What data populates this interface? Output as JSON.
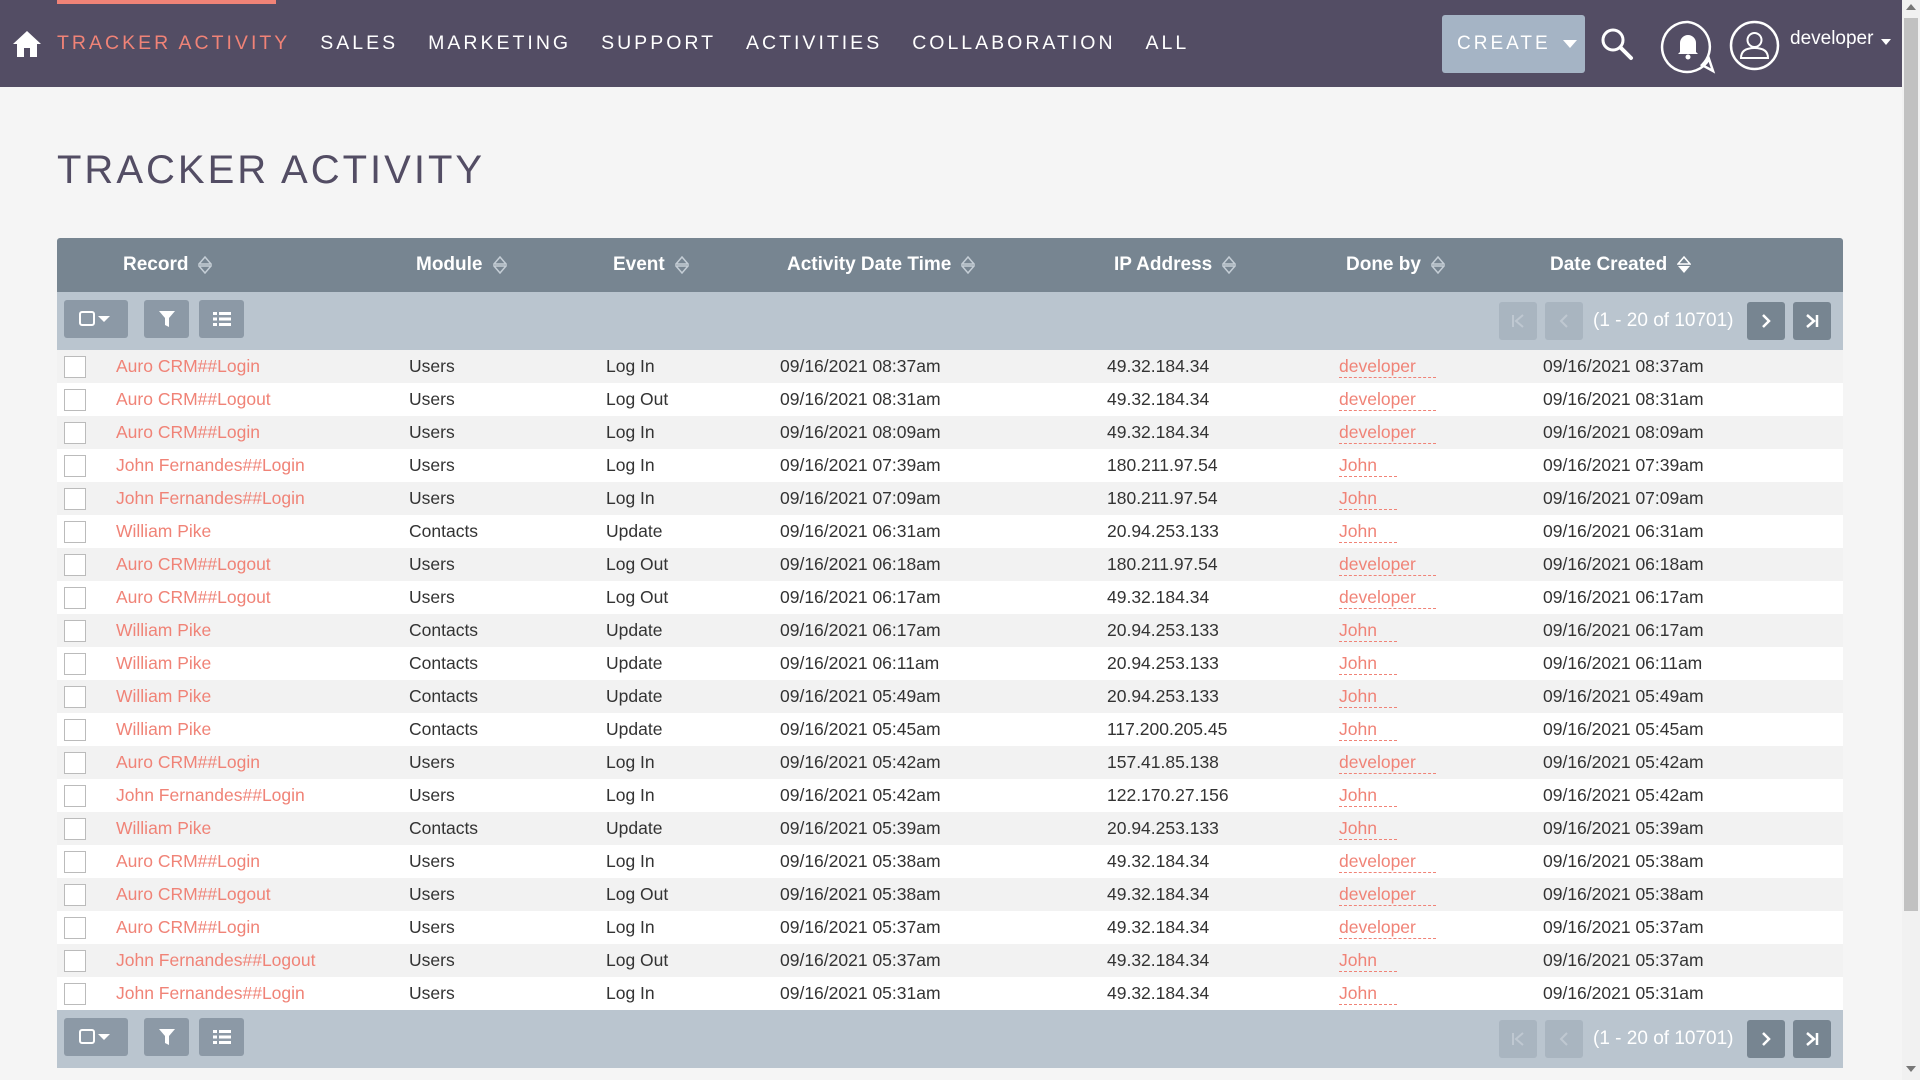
{
  "nav": {
    "items": [
      {
        "label": "TRACKER ACTIVITY",
        "active": true
      },
      {
        "label": "SALES"
      },
      {
        "label": "MARKETING"
      },
      {
        "label": "SUPPORT"
      },
      {
        "label": "ACTIVITIES"
      },
      {
        "label": "COLLABORATION"
      },
      {
        "label": "ALL"
      }
    ],
    "create_label": "CREATE",
    "user_name": "developer",
    "icons": [
      "home-icon",
      "search-icon",
      "bell-icon",
      "user-icon"
    ]
  },
  "colors": {
    "nav_bg": "#534d64",
    "accent": "#f08377",
    "header_bg": "#778591",
    "toolbar_bg": "#bac5cf",
    "create_bg": "#a5b4c5"
  },
  "page": {
    "title": "TRACKER ACTIVITY"
  },
  "table": {
    "columns": [
      "Record",
      "Module",
      "Event",
      "Activity Date Time",
      "IP Address",
      "Done by",
      "Date Created"
    ],
    "sorted_column": "Date Created",
    "pagination": "(1 - 20 of 10701)",
    "rows": [
      {
        "record": "Auro CRM##Login",
        "module": "Users",
        "event": "Log In",
        "activity": "09/16/2021 08:37am",
        "ip": "49.32.184.34",
        "done_by": "developer",
        "created": "09/16/2021 08:37am"
      },
      {
        "record": "Auro CRM##Logout",
        "module": "Users",
        "event": "Log Out",
        "activity": "09/16/2021 08:31am",
        "ip": "49.32.184.34",
        "done_by": "developer",
        "created": "09/16/2021 08:31am"
      },
      {
        "record": "Auro CRM##Login",
        "module": "Users",
        "event": "Log In",
        "activity": "09/16/2021 08:09am",
        "ip": "49.32.184.34",
        "done_by": "developer",
        "created": "09/16/2021 08:09am"
      },
      {
        "record": "John Fernandes##Login",
        "module": "Users",
        "event": "Log In",
        "activity": "09/16/2021 07:39am",
        "ip": "180.211.97.54",
        "done_by": "John",
        "created": "09/16/2021 07:39am"
      },
      {
        "record": "John Fernandes##Login",
        "module": "Users",
        "event": "Log In",
        "activity": "09/16/2021 07:09am",
        "ip": "180.211.97.54",
        "done_by": "John",
        "created": "09/16/2021 07:09am"
      },
      {
        "record": "William Pike",
        "module": "Contacts",
        "event": "Update",
        "activity": "09/16/2021 06:31am",
        "ip": "20.94.253.133",
        "done_by": "John",
        "created": "09/16/2021 06:31am"
      },
      {
        "record": "Auro CRM##Logout",
        "module": "Users",
        "event": "Log Out",
        "activity": "09/16/2021 06:18am",
        "ip": "180.211.97.54",
        "done_by": "developer",
        "created": "09/16/2021 06:18am"
      },
      {
        "record": "Auro CRM##Logout",
        "module": "Users",
        "event": "Log Out",
        "activity": "09/16/2021 06:17am",
        "ip": "49.32.184.34",
        "done_by": "developer",
        "created": "09/16/2021 06:17am"
      },
      {
        "record": "William Pike",
        "module": "Contacts",
        "event": "Update",
        "activity": "09/16/2021 06:17am",
        "ip": "20.94.253.133",
        "done_by": "John",
        "created": "09/16/2021 06:17am"
      },
      {
        "record": "William Pike",
        "module": "Contacts",
        "event": "Update",
        "activity": "09/16/2021 06:11am",
        "ip": "20.94.253.133",
        "done_by": "John",
        "created": "09/16/2021 06:11am"
      },
      {
        "record": "William Pike",
        "module": "Contacts",
        "event": "Update",
        "activity": "09/16/2021 05:49am",
        "ip": "20.94.253.133",
        "done_by": "John",
        "created": "09/16/2021 05:49am"
      },
      {
        "record": "William Pike",
        "module": "Contacts",
        "event": "Update",
        "activity": "09/16/2021 05:45am",
        "ip": "117.200.205.45",
        "done_by": "John",
        "created": "09/16/2021 05:45am"
      },
      {
        "record": "Auro CRM##Login",
        "module": "Users",
        "event": "Log In",
        "activity": "09/16/2021 05:42am",
        "ip": "157.41.85.138",
        "done_by": "developer",
        "created": "09/16/2021 05:42am"
      },
      {
        "record": "John Fernandes##Login",
        "module": "Users",
        "event": "Log In",
        "activity": "09/16/2021 05:42am",
        "ip": "122.170.27.156",
        "done_by": "John",
        "created": "09/16/2021 05:42am"
      },
      {
        "record": "William Pike",
        "module": "Contacts",
        "event": "Update",
        "activity": "09/16/2021 05:39am",
        "ip": "20.94.253.133",
        "done_by": "John",
        "created": "09/16/2021 05:39am"
      },
      {
        "record": "Auro CRM##Login",
        "module": "Users",
        "event": "Log In",
        "activity": "09/16/2021 05:38am",
        "ip": "49.32.184.34",
        "done_by": "developer",
        "created": "09/16/2021 05:38am"
      },
      {
        "record": "Auro CRM##Logout",
        "module": "Users",
        "event": "Log Out",
        "activity": "09/16/2021 05:38am",
        "ip": "49.32.184.34",
        "done_by": "developer",
        "created": "09/16/2021 05:38am"
      },
      {
        "record": "Auro CRM##Login",
        "module": "Users",
        "event": "Log In",
        "activity": "09/16/2021 05:37am",
        "ip": "49.32.184.34",
        "done_by": "developer",
        "created": "09/16/2021 05:37am"
      },
      {
        "record": "John Fernandes##Logout",
        "module": "Users",
        "event": "Log Out",
        "activity": "09/16/2021 05:37am",
        "ip": "49.32.184.34",
        "done_by": "John",
        "created": "09/16/2021 05:37am"
      },
      {
        "record": "John Fernandes##Login",
        "module": "Users",
        "event": "Log In",
        "activity": "09/16/2021 05:31am",
        "ip": "49.32.184.34",
        "done_by": "John",
        "created": "09/16/2021 05:31am"
      }
    ]
  }
}
